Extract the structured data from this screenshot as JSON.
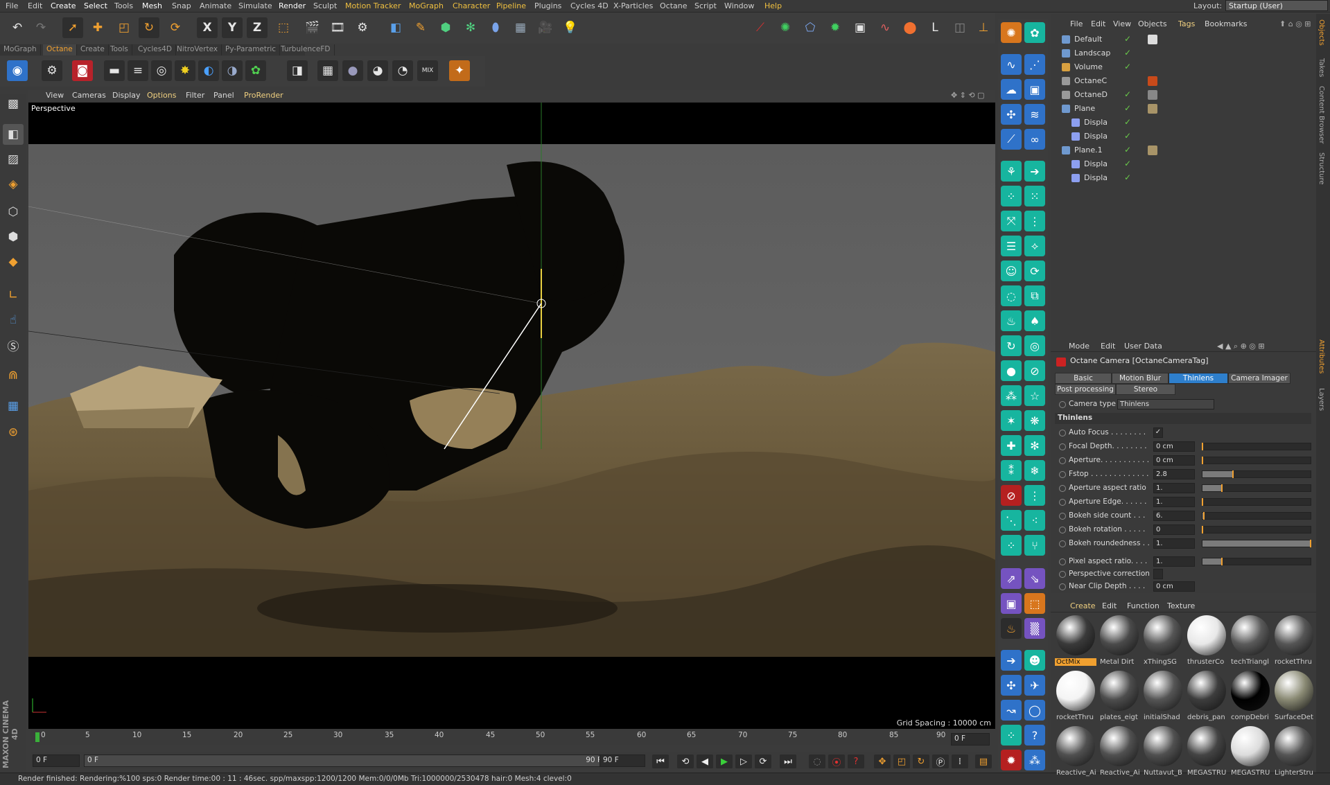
{
  "menu": [
    "File",
    "Edit",
    "Create",
    "Select",
    "Tools",
    "Mesh",
    "Snap",
    "Animate",
    "Simulate",
    "Render",
    "Sculpt",
    "Motion Tracker",
    "MoGraph",
    "Character",
    "Pipeline",
    "Plugins",
    "Cycles 4D",
    "X-Particles",
    "Octane",
    "Script",
    "Window",
    "Help"
  ],
  "layout": {
    "label": "Layout:",
    "value": "Startup (User)"
  },
  "toolbar_tabs": [
    "MoGraph",
    "Octane",
    "Create",
    "Tools",
    "Cycles4D",
    "NitroVertex",
    "Py-Parametric",
    "TurbulenceFD"
  ],
  "active_toolbar_tab": "Octane",
  "axis_buttons": [
    "X",
    "Y",
    "Z"
  ],
  "viewport": {
    "menu": [
      "View",
      "Cameras",
      "Display",
      "Options",
      "Filter",
      "Panel",
      "ProRender"
    ],
    "label": "Perspective",
    "grid_spacing": "Grid Spacing : 10000 cm"
  },
  "timeline": {
    "ticks": [
      "0",
      "5",
      "10",
      "15",
      "20",
      "25",
      "30",
      "35",
      "40",
      "45",
      "50",
      "55",
      "60",
      "65",
      "70",
      "75",
      "80",
      "85",
      "90"
    ],
    "frame_end_label": "0 F"
  },
  "transport": {
    "current_frame": "0 F",
    "range_start": "0 F",
    "range_end": "90 F",
    "end_frame": "90 F"
  },
  "status": "Render finished: Rendering:%100 sps:0 Render time:00 : 11 : 46sec. spp/maxspp:1200/1200 Mem:0/0/0Mb Tri:1000000/2530478 hair:0 Mesh:4 clevel:0",
  "object_manager": {
    "menu": [
      "File",
      "Edit",
      "View",
      "Objects",
      "Tags",
      "Bookmarks"
    ],
    "objects": [
      {
        "name": "Default",
        "color": "#7aa4d8"
      },
      {
        "name": "Landscap",
        "color": "#7aa4d8"
      },
      {
        "name": "Volume",
        "color": "#d8a040"
      },
      {
        "name": "OctaneC",
        "color": "#aaaaaa"
      },
      {
        "name": "OctaneD",
        "color": "#aaaaaa"
      },
      {
        "name": "Plane",
        "color": "#7aa4d8"
      },
      {
        "name": "Displa",
        "color": "#8d9ff0"
      },
      {
        "name": "Displa",
        "color": "#8d9ff0"
      },
      {
        "name": "Plane.1",
        "color": "#7aa4d8"
      },
      {
        "name": "Displa",
        "color": "#8d9ff0"
      },
      {
        "name": "Displa",
        "color": "#8d9ff0"
      }
    ]
  },
  "attributes": {
    "menu": [
      "Mode",
      "Edit",
      "User Data"
    ],
    "title": "Octane Camera [OctaneCameraTag]",
    "tabs_row1": [
      "Basic",
      "Motion Blur",
      "Thinlens",
      "Camera Imager"
    ],
    "tabs_row2": [
      "Post processing",
      "Stereo"
    ],
    "active_tab": "Thinlens",
    "camera_type_label": "Camera type",
    "camera_type_value": "Thinlens",
    "section": "Thinlens",
    "params": [
      {
        "label": "Auto Focus . . . . . . . .",
        "value": "✓",
        "fill": null
      },
      {
        "label": "Focal Depth. . . . . . . .",
        "value": "0 cm",
        "fill": 0.0
      },
      {
        "label": "Aperture. . . . . . . . . . .",
        "value": "0 cm",
        "fill": 0.0
      },
      {
        "label": "Fstop . . . . . . . . . . . . .",
        "value": "2.8",
        "fill": 0.28
      },
      {
        "label": "Aperture aspect ratio",
        "value": "1.",
        "fill": 0.18
      },
      {
        "label": "Aperture Edge. . . . . .",
        "value": "1.",
        "fill": 0.0
      },
      {
        "label": "Bokeh side count . . .",
        "value": "6.",
        "fill": 0.01
      },
      {
        "label": "Bokeh rotation . . . . .",
        "value": "0",
        "fill": 0.0
      },
      {
        "label": "Bokeh roundedness . .",
        "value": "1.",
        "fill": 1.0
      },
      {
        "label": "Pixel aspect ratio. . . .",
        "value": "1.",
        "fill": 0.18
      },
      {
        "label": "Perspective correction",
        "value": "",
        "fill": null
      },
      {
        "label": "Near Clip Depth . . . .",
        "value": "0 cm",
        "fill": null
      }
    ]
  },
  "material_manager": {
    "menu": [
      "Create",
      "Edit",
      "Function",
      "Texture"
    ],
    "materials": [
      {
        "name": "OctMix",
        "color": "#3a3a3a",
        "selected": true
      },
      {
        "name": "Metal Dirt",
        "color": "#4a4a4a"
      },
      {
        "name": "xThingSG",
        "color": "#555555"
      },
      {
        "name": "thrusterCo",
        "color": "#e8e8e8"
      },
      {
        "name": "techTriangl",
        "color": "#5a5a5a"
      },
      {
        "name": "rocketThru",
        "color": "#555555"
      },
      {
        "name": "rocketThru",
        "color": "#f4f4f4"
      },
      {
        "name": "plates_eigt",
        "color": "#4d4d4d"
      },
      {
        "name": "initialShad",
        "color": "#555555"
      },
      {
        "name": "debris_pan",
        "color": "#3d3d3d"
      },
      {
        "name": "compDebri",
        "color": "#000000"
      },
      {
        "name": "SurfaceDet",
        "color": "#8a8a74"
      },
      {
        "name": "Reactive_Ai",
        "color": "#505050"
      },
      {
        "name": "Reactive_Ai",
        "color": "#505050"
      },
      {
        "name": "Nuttavut_B",
        "color": "#505050"
      },
      {
        "name": "MEGASTRU",
        "color": "#444444"
      },
      {
        "name": "MEGASTRU",
        "color": "#dcdcdc"
      },
      {
        "name": "LighterStru",
        "color": "#555555"
      }
    ]
  },
  "side_tabs": [
    "Objects",
    "Takes",
    "Content Browser",
    "Structure",
    "Attributes",
    "Layers"
  ],
  "branding": "MAXON CINEMA 4D"
}
